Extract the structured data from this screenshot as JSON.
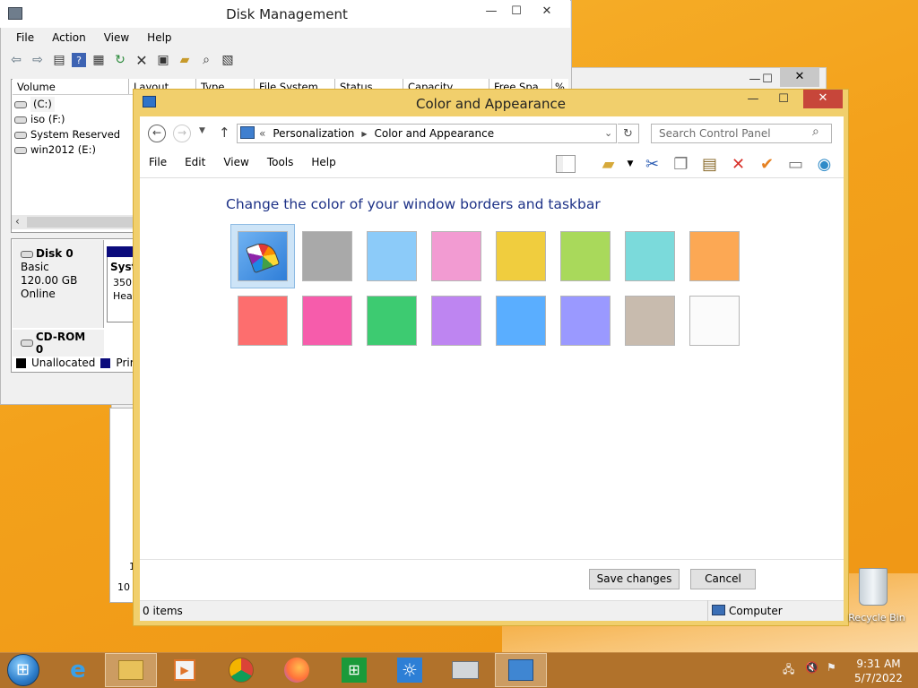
{
  "disk_management": {
    "title": "Disk Management",
    "menu": [
      "File",
      "Action",
      "View",
      "Help"
    ],
    "columns": [
      "Volume",
      "Layout",
      "Type",
      "File System",
      "Status",
      "Capacity",
      "Free Spa...",
      "%"
    ],
    "volumes": [
      "(C:)",
      "iso (F:)",
      "System Reserved",
      "win2012 (E:)"
    ],
    "disk0": {
      "name": "Disk 0",
      "type": "Basic",
      "size": "120.00 GB",
      "state": "Online"
    },
    "partition": {
      "label": "Syste",
      "size": "350",
      "status": "Hea"
    },
    "cdrom": "CD-ROM 0",
    "legend": [
      {
        "label": "Unallocated",
        "color": "#000000"
      },
      {
        "label": "Prima",
        "color": "#0b0b7c"
      }
    ]
  },
  "background_window": {
    "line1": "1",
    "line2": "10"
  },
  "control_panel": {
    "title": "Color and Appearance",
    "breadcrumb": [
      "Personalization",
      "Color and Appearance"
    ],
    "breadcrumb_prefix": "«",
    "search_placeholder": "Search Control Panel",
    "menu": [
      "File",
      "Edit",
      "View",
      "Tools",
      "Help"
    ],
    "heading": "Change the color of your window borders and taskbar",
    "swatches_row1": [
      "automatic",
      "#a9a9a9",
      "#8ccbf9",
      "#f29bd2",
      "#f0cd3e",
      "#a9d95b",
      "#7bdadb",
      "#fca854"
    ],
    "swatches_row2": [
      "#fd6e6e",
      "#f65cab",
      "#3dcb71",
      "#be85f1",
      "#5aaeff",
      "#9a99ff",
      "#c8bbae",
      "#fbfbfb"
    ],
    "save_label": "Save changes",
    "cancel_label": "Cancel",
    "status_items": "0 items",
    "status_location": "Computer"
  },
  "desktop": {
    "recycle_bin": "Recycle Bin"
  },
  "clock": {
    "time": "9:31 AM",
    "date": "5/7/2022"
  }
}
